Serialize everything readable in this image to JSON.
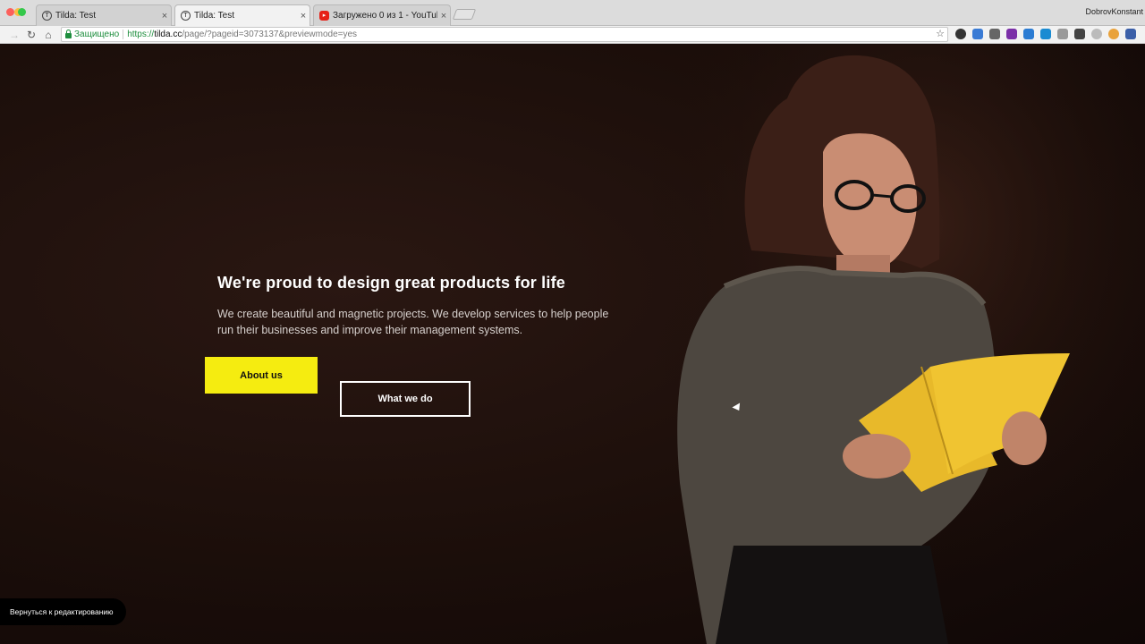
{
  "browser": {
    "tabs": [
      {
        "label": "Tilda: Test",
        "icon": "tilda-favicon-icon",
        "active": false
      },
      {
        "label": "Tilda: Test",
        "icon": "tilda-favicon-icon",
        "active": true
      },
      {
        "label": "Загружено 0 из 1 - YouTube",
        "icon": "youtube-favicon-icon",
        "active": false
      }
    ],
    "profile_name": "DobrovKonstant",
    "secure_label": "Защищено",
    "url": {
      "scheme": "https://",
      "host": "tilda.cc",
      "path": "/page/?pageid=3073137&previewmode=yes"
    }
  },
  "hero": {
    "title": "We're proud to design great products for life",
    "text": "We create beautiful and magnetic projects. We develop services to help people run their businesses and improve their management systems.",
    "primary_button": "About us",
    "secondary_button": "What we do",
    "accent_color": "#f5ec10"
  },
  "editor": {
    "back_label": "Вернуться к редактированию"
  }
}
